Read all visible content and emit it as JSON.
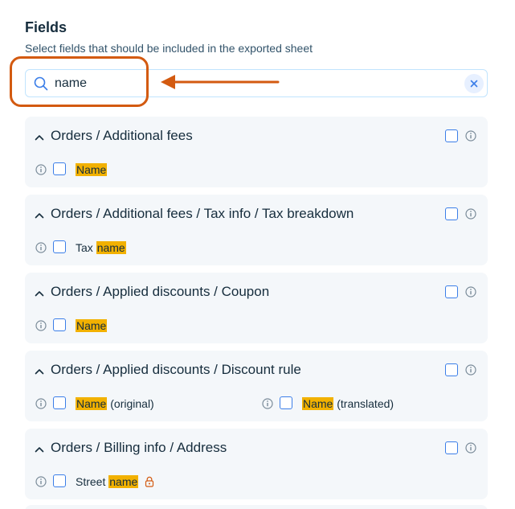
{
  "header": {
    "title": "Fields",
    "subtitle": "Select fields that should be included in the exported sheet"
  },
  "search": {
    "value": "name",
    "icon": "search-icon",
    "clear_icon": "close-icon"
  },
  "colors": {
    "accent": "#3b7ee8",
    "highlight": "#f2b100",
    "annotation": "#d35a10",
    "group_bg": "#f4f7fa"
  },
  "groups": [
    {
      "title": "Orders / Additional fees",
      "fields": [
        {
          "pre": "",
          "match": "Name",
          "post": ""
        }
      ]
    },
    {
      "title": "Orders / Additional fees / Tax info / Tax breakdown",
      "fields": [
        {
          "pre": "Tax ",
          "match": "name",
          "post": ""
        }
      ]
    },
    {
      "title": "Orders / Applied discounts / Coupon",
      "fields": [
        {
          "pre": "",
          "match": "Name",
          "post": ""
        }
      ]
    },
    {
      "title": "Orders / Applied discounts / Discount rule",
      "fields": [
        {
          "pre": "",
          "match": "Name",
          "post": " (original)"
        },
        {
          "pre": "",
          "match": "Name",
          "post": " (translated)"
        }
      ]
    },
    {
      "title": "Orders / Billing info / Address",
      "fields": [
        {
          "pre": "Street ",
          "match": "name",
          "post": "",
          "locked": true
        }
      ]
    }
  ]
}
